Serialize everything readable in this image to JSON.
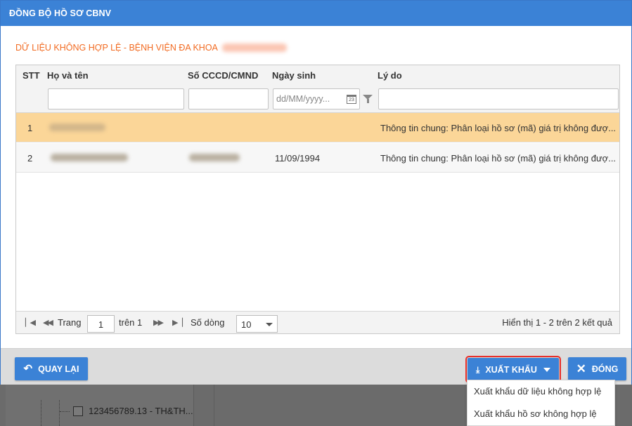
{
  "dialog": {
    "title": "ĐỒNG BỘ HỒ SƠ CBNV",
    "subtitle": "DỮ LIỆU KHÔNG HỢP LỆ - BỆNH VIỆN ĐA KHOA"
  },
  "grid": {
    "columns": [
      "STT",
      "Họ và tên",
      "Số CCCD/CMND",
      "Ngày sinh",
      "Lý do"
    ],
    "date_placeholder": "dd/MM/yyyy...",
    "rows": [
      {
        "stt": "1",
        "dob": "",
        "reason": "Thông tin chung: Phân loại hồ sơ (mã) giá trị không đượ..."
      },
      {
        "stt": "2",
        "dob": "11/09/1994",
        "reason": "Thông tin chung: Phân loại hồ sơ (mã) giá trị không đượ..."
      }
    ]
  },
  "pager": {
    "page_label": "Trang",
    "page_value": "1",
    "of_label": "trên 1",
    "rows_label": "Số dòng",
    "rows_value": "10",
    "info": "Hiển thị 1 - 2 trên 2 kết quả"
  },
  "footer": {
    "back_label": "QUAY LẠI",
    "export_label": "XUẤT KHẨU",
    "close_label": "ĐÓNG"
  },
  "export_menu": {
    "items": [
      "Xuất khẩu dữ liệu không hợp lệ",
      "Xuất khẩu hồ sơ không hợp lệ"
    ]
  },
  "background": {
    "tree_item": "123456789.13 - TH&TH..."
  },
  "colors": {
    "header_blue": "#3b82d6",
    "subtitle_orange": "#f26b22",
    "selected_row": "#fbd698",
    "highlight_red": "#e8302a"
  }
}
